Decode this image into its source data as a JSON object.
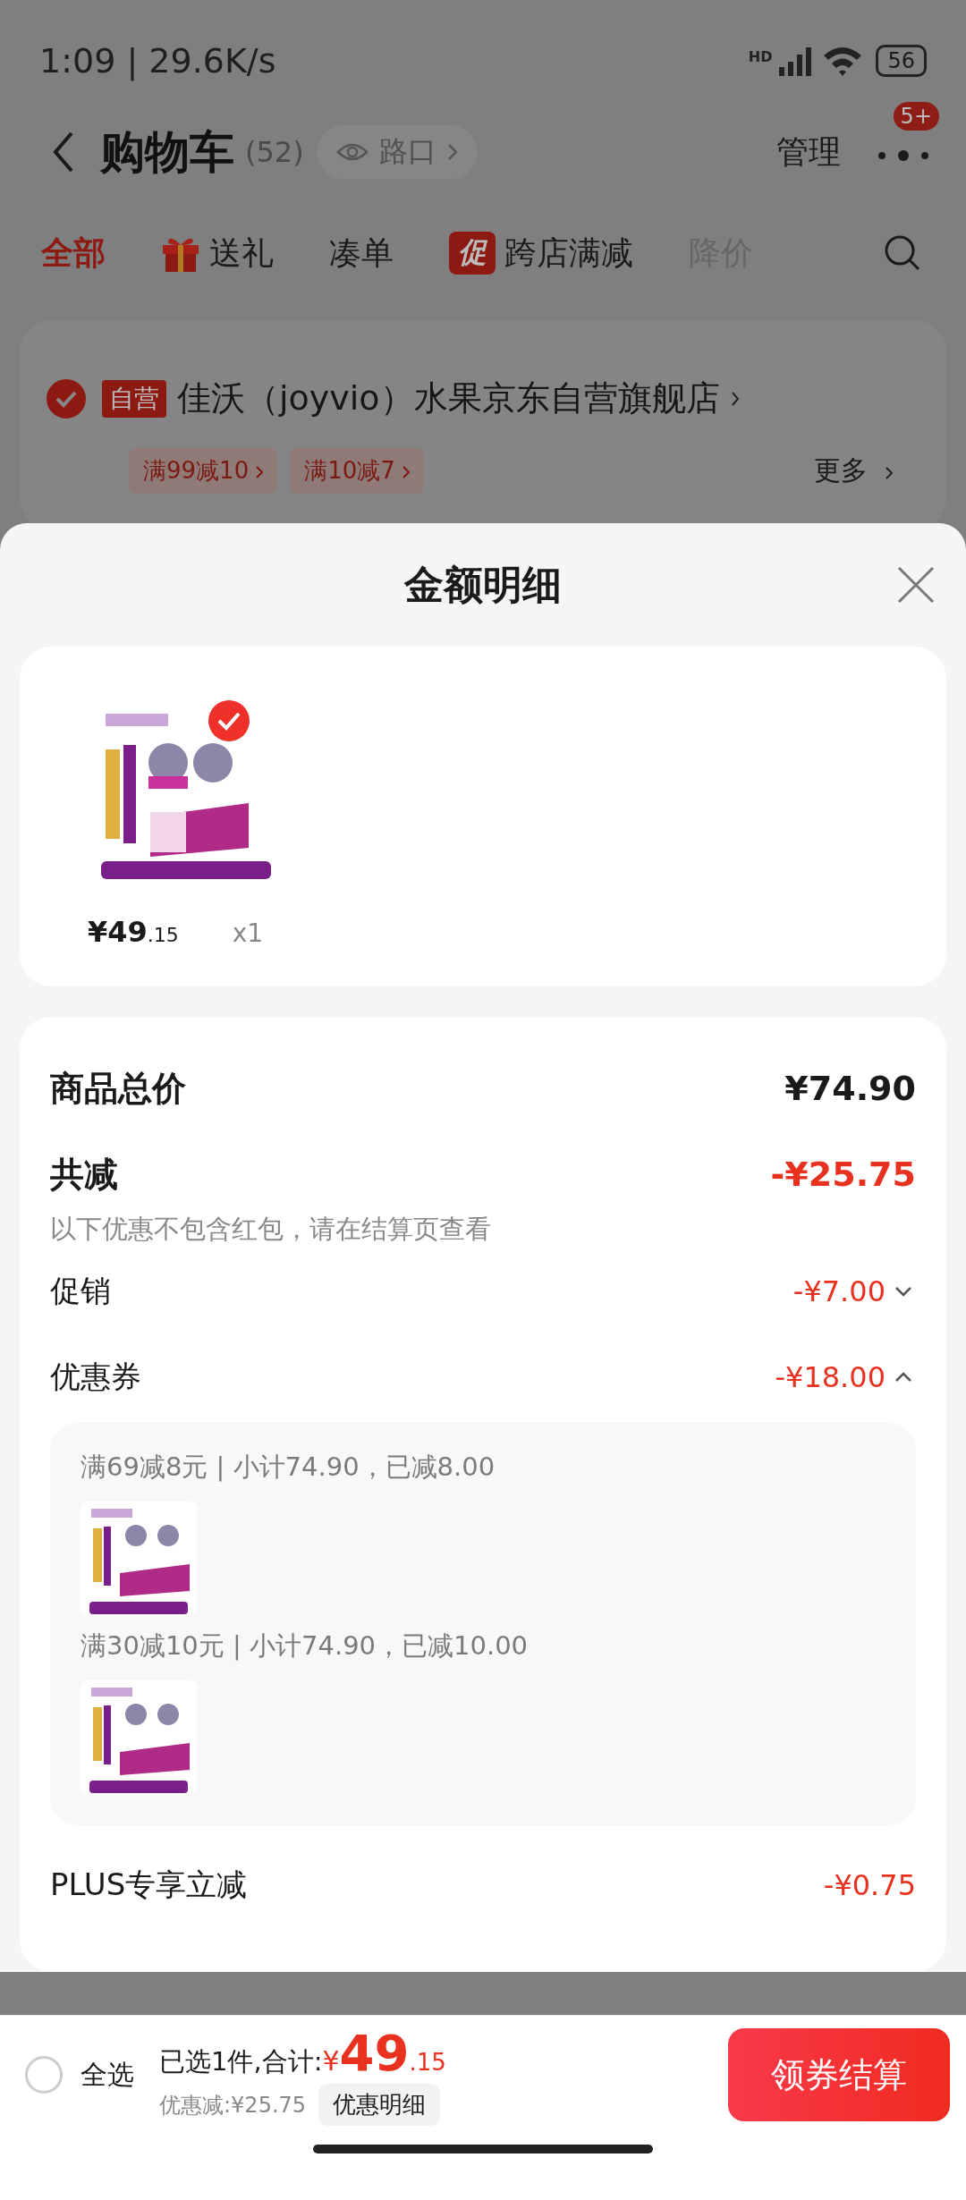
{
  "status_bar": {
    "time": "1:09 | 29.6K/s",
    "network": "HD",
    "battery": "56"
  },
  "header": {
    "title": "购物车",
    "count": "(52)",
    "chip": "路口",
    "manage": "管理",
    "badge": "5+"
  },
  "tabs": [
    {
      "label": "全部",
      "selected": true,
      "kind": "plain",
      "faded": false
    },
    {
      "label": "送礼",
      "selected": false,
      "kind": "gift",
      "faded": false
    },
    {
      "label": "凑单",
      "selected": false,
      "kind": "plain",
      "faded": false
    },
    {
      "label": "跨店满减",
      "selected": false,
      "kind": "promo",
      "tag": "促",
      "faded": false
    },
    {
      "label": "降价",
      "selected": false,
      "kind": "plain",
      "faded": true
    }
  ],
  "store": {
    "checked": true,
    "tag": "自营",
    "name": "佳沃（joyvio）水果京东自营旗舰店",
    "coupons": [
      "满99减10",
      "满10减7"
    ],
    "more": "更多"
  },
  "sheet": {
    "title": "金额明细",
    "product": {
      "price": "¥49",
      "price_decimal": ".15",
      "quantity": "x1"
    },
    "total": {
      "label": "商品总价",
      "value": "¥74.90"
    },
    "discount": {
      "label": "共减",
      "value": "-¥25.75",
      "note": "以下优惠不包含红包，请在结算页查看"
    },
    "lines": [
      {
        "label": "促销",
        "value": "-¥7.00",
        "kind": "expandable",
        "expanded": false
      },
      {
        "label": "优惠券",
        "value": "-¥18.00",
        "kind": "expandable",
        "expanded": true,
        "coupons": [
          {
            "text": "满69减8元 | 小计74.90，已减8.00"
          },
          {
            "text": "满30减10元 | 小计74.90，已减10.00"
          }
        ]
      },
      {
        "label": "PLUS专享立减",
        "value": "-¥0.75",
        "kind": "plain"
      }
    ]
  },
  "bottom_bar": {
    "select_all": {
      "label": "全选",
      "checked": false
    },
    "summary": "已选1件,合计:",
    "currency": "¥",
    "total": "49",
    "total_decimal": ".15",
    "saved": "优惠减:¥25.75",
    "detail_button": "优惠明细",
    "checkout": "领券结算"
  }
}
